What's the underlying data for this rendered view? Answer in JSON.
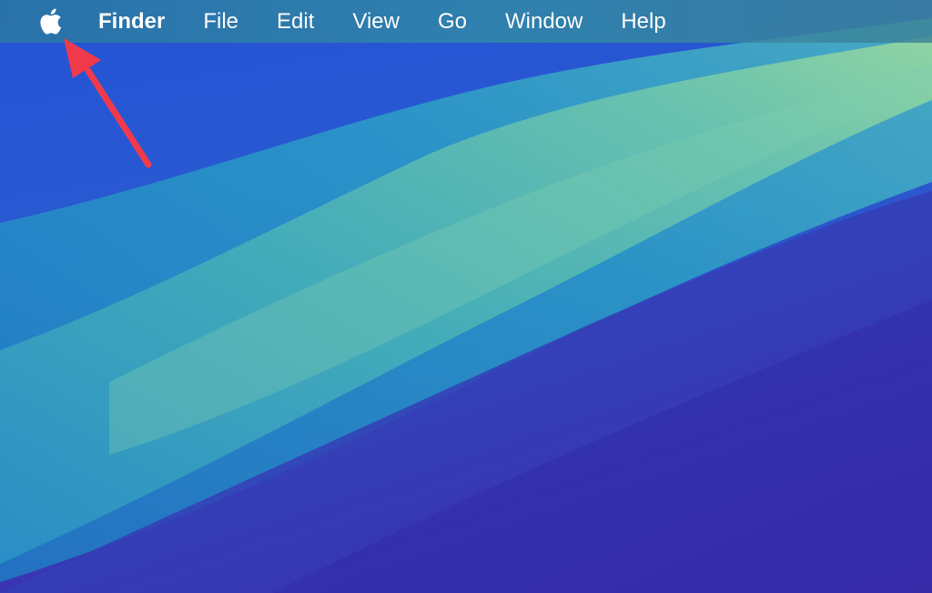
{
  "menubar": {
    "apple_icon": "apple-logo-icon",
    "app_name": "Finder",
    "items": [
      {
        "label": "File"
      },
      {
        "label": "Edit"
      },
      {
        "label": "View"
      },
      {
        "label": "Go"
      },
      {
        "label": "Window"
      },
      {
        "label": "Help"
      }
    ]
  },
  "annotation": {
    "icon": "arrow-pointer-icon",
    "color": "#f03a4c"
  },
  "colors": {
    "wallpaper_deep_blue": "#2a4fc8",
    "wallpaper_purple": "#3c2fb0",
    "wallpaper_teal": "#4fb3b5",
    "wallpaper_mint": "#8fd3a5"
  }
}
